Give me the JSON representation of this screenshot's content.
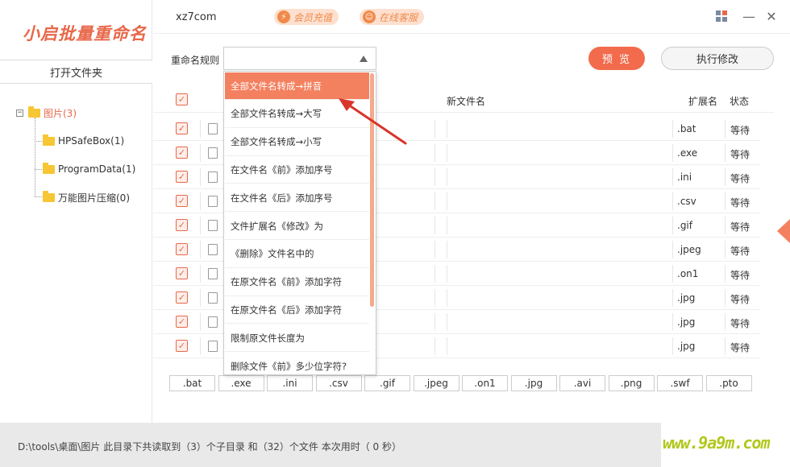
{
  "app": {
    "logo": "小启批量重命名",
    "site": "xz7com",
    "vip_label": "会员充值",
    "service_label": "在线客服"
  },
  "sidebar": {
    "open_folder": "打开文件夹",
    "tree": {
      "root": "图片(3)",
      "children": [
        "HPSafeBox(1)",
        "ProgramData(1)",
        "万能图片压缩(0)"
      ]
    }
  },
  "toolbar": {
    "rule_label": "重命名规则",
    "preview_label": "预 览",
    "execute_label": "执行修改"
  },
  "rule_options": [
    "全部文件名转成→拼音",
    "全部文件名转成→大写",
    "全部文件名转成→小写",
    "在文件名《前》添加序号",
    "在文件名《后》添加序号",
    "文件扩展名《修改》为",
    "《删除》文件名中的",
    "在原文件名《前》添加字符",
    "在原文件名《后》添加字符",
    "限制原文件长度为",
    "删除文件《前》多少位字符?"
  ],
  "table": {
    "headers": {
      "new_name": "新文件名",
      "ext": "扩展名",
      "status": "状态"
    },
    "rows": [
      {
        "ext": ".bat",
        "status": "等待"
      },
      {
        "ext": ".exe",
        "status": "等待"
      },
      {
        "ext": ".ini",
        "status": "等待"
      },
      {
        "ext": ".csv",
        "status": "等待"
      },
      {
        "ext": ".gif",
        "status": "等待"
      },
      {
        "ext": ".jpeg",
        "status": "等待"
      },
      {
        "ext": ".on1",
        "status": "等待"
      },
      {
        "ext": ".jpg",
        "status": "等待"
      },
      {
        "ext": ".jpg",
        "status": "等待"
      },
      {
        "ext": ".jpg",
        "status": "等待"
      }
    ]
  },
  "ext_filters": [
    ".bat",
    ".exe",
    ".ini",
    ".csv",
    ".gif",
    ".jpeg",
    ".on1",
    ".jpg",
    ".avi",
    ".png",
    ".swf",
    ".pto"
  ],
  "status_bar": "D:\\tools\\桌面\\图片 此目录下共读取到（3）个子目录 和（32）个文件 本次用时（ 0 秒）",
  "watermark": "www.9a9m.com",
  "colors": {
    "accent": "#f26b4d",
    "highlight": "#f3805f",
    "watermark": "#b2c71b"
  }
}
